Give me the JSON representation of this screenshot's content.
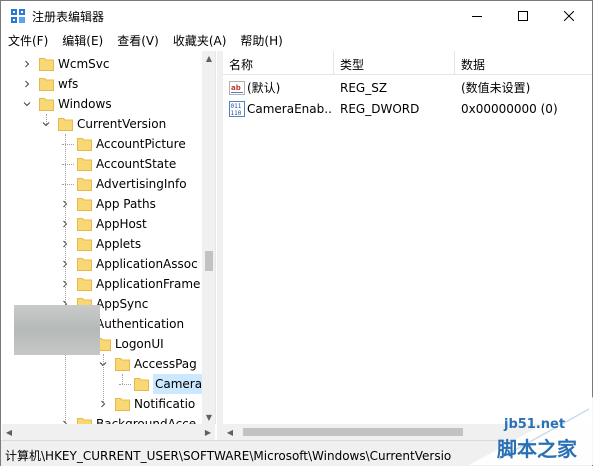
{
  "window": {
    "title": "注册表编辑器"
  },
  "menu": [
    "文件(F)",
    "编辑(E)",
    "查看(V)",
    "收藏夹(A)",
    "帮助(H)"
  ],
  "tree": [
    {
      "label": "WcmSvc",
      "level": 0,
      "expander": "collapsed"
    },
    {
      "label": "wfs",
      "level": 0,
      "expander": "collapsed"
    },
    {
      "label": "Windows",
      "level": 0,
      "expander": "expanded"
    },
    {
      "label": "CurrentVersion",
      "level": 1,
      "expander": "expanded"
    },
    {
      "label": "AccountPicture",
      "level": 2,
      "expander": "none"
    },
    {
      "label": "AccountState",
      "level": 2,
      "expander": "none"
    },
    {
      "label": "AdvertisingInfo",
      "level": 2,
      "expander": "none"
    },
    {
      "label": "App Paths",
      "level": 2,
      "expander": "collapsed"
    },
    {
      "label": "AppHost",
      "level": 2,
      "expander": "collapsed"
    },
    {
      "label": "Applets",
      "level": 2,
      "expander": "collapsed"
    },
    {
      "label": "ApplicationAssoc",
      "level": 2,
      "expander": "collapsed"
    },
    {
      "label": "ApplicationFrame",
      "level": 2,
      "expander": "collapsed"
    },
    {
      "label": "AppSync",
      "level": 2,
      "expander": "collapsed"
    },
    {
      "label": "Authentication",
      "level": 2,
      "expander": "expanded"
    },
    {
      "label": "LogonUI",
      "level": 3,
      "expander": "expanded"
    },
    {
      "label": "AccessPag",
      "level": 4,
      "expander": "expanded"
    },
    {
      "label": "Camera",
      "level": 5,
      "expander": "none",
      "selected": true
    },
    {
      "label": "Notificatio",
      "level": 4,
      "expander": "collapsed"
    },
    {
      "label": "BackgroundAcce",
      "level": 2,
      "expander": "collapsed"
    }
  ],
  "list": {
    "columns": [
      "名称",
      "类型",
      "数据"
    ],
    "rows": [
      {
        "icon": "string-value-icon",
        "name": "(默认)",
        "type": "REG_SZ",
        "data": "(数值未设置)"
      },
      {
        "icon": "binary-value-icon",
        "name": "CameraEnab...",
        "type": "REG_DWORD",
        "data": "0x00000000 (0)"
      }
    ]
  },
  "status": {
    "path": "计算机\\HKEY_CURRENT_USER\\SOFTWARE\\Microsoft\\Windows\\CurrentVersio"
  },
  "watermark": {
    "top": "jb51.net",
    "bottom": "脚本之家"
  },
  "colors": {
    "selection": "#cce8ff",
    "folder": "#f8d775",
    "folder_dark": "#e8b84a",
    "watermark": "#2a70b5"
  }
}
